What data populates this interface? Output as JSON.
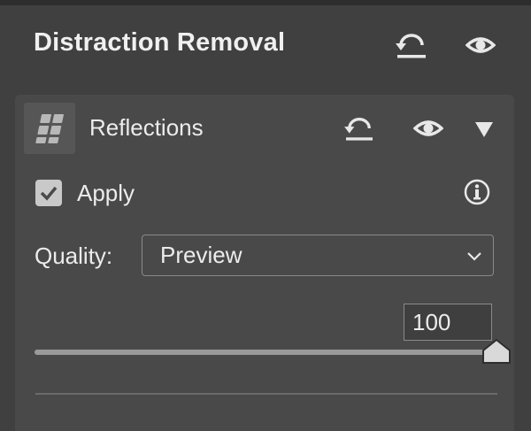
{
  "panel": {
    "title": "Distraction Removal",
    "reset_icon": "reset-icon",
    "visibility_icon": "eye-icon"
  },
  "section": {
    "title": "Reflections",
    "thumbnail_icon": "reflections-icon",
    "reset_icon": "reset-icon",
    "visibility_icon": "eye-icon",
    "collapse_icon": "triangle-down-icon",
    "apply": {
      "label": "Apply",
      "checked": true
    },
    "info_icon": "info-icon",
    "quality": {
      "label": "Quality:",
      "value": "Preview"
    },
    "amount": {
      "value": "100",
      "max": 100
    }
  },
  "colors": {
    "background": "#404040",
    "section_background": "#494949",
    "text": "#ececec",
    "checkbox": "#c9c9c9"
  }
}
